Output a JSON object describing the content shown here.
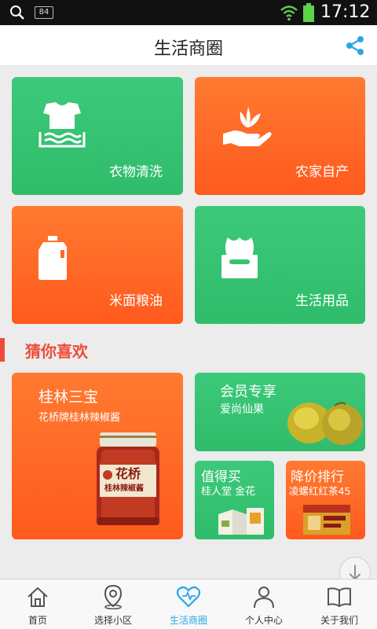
{
  "status_bar": {
    "badge": "84",
    "time": "17:12",
    "icons": [
      "search-icon",
      "wifi-icon",
      "battery-icon"
    ]
  },
  "header": {
    "title": "生活商圈",
    "share_icon": "share-icon"
  },
  "categories": [
    {
      "label": "衣物清洗",
      "icon": "laundry-icon",
      "color": "#34c472"
    },
    {
      "label": "农家自产",
      "icon": "farm-hand-icon",
      "color": "#ff6a26"
    },
    {
      "label": "米面粮油",
      "icon": "oil-bottle-icon",
      "color": "#ff6a26"
    },
    {
      "label": "生活用品",
      "icon": "tissue-box-icon",
      "color": "#34c472"
    }
  ],
  "section": {
    "title": "猜你喜欢",
    "accent": "#f04a3a"
  },
  "recommendations": {
    "card1": {
      "title": "桂林三宝",
      "subtitle": "花桥牌桂林辣椒酱",
      "jar_text": "花桥",
      "jar_text2": "桂林辣椒酱"
    },
    "card2": {
      "title": "会员专享",
      "subtitle": "爱尚仙果"
    },
    "card3": {
      "title": "值得买",
      "subtitle": "桂人堂 金花"
    },
    "card4": {
      "title": "降价排行",
      "subtitle": "凌螺红红茶45"
    }
  },
  "bottom_nav": [
    {
      "label": "首页",
      "icon": "home-icon",
      "active": false
    },
    {
      "label": "选择小区",
      "icon": "location-icon",
      "active": false
    },
    {
      "label": "生活商圈",
      "icon": "heart-icon",
      "active": true
    },
    {
      "label": "个人中心",
      "icon": "person-icon",
      "active": false
    },
    {
      "label": "关于我们",
      "icon": "book-icon",
      "active": false
    }
  ],
  "colors": {
    "green": "#34c472",
    "orange": "#ff6a26",
    "active_nav": "#2aa6e8"
  }
}
